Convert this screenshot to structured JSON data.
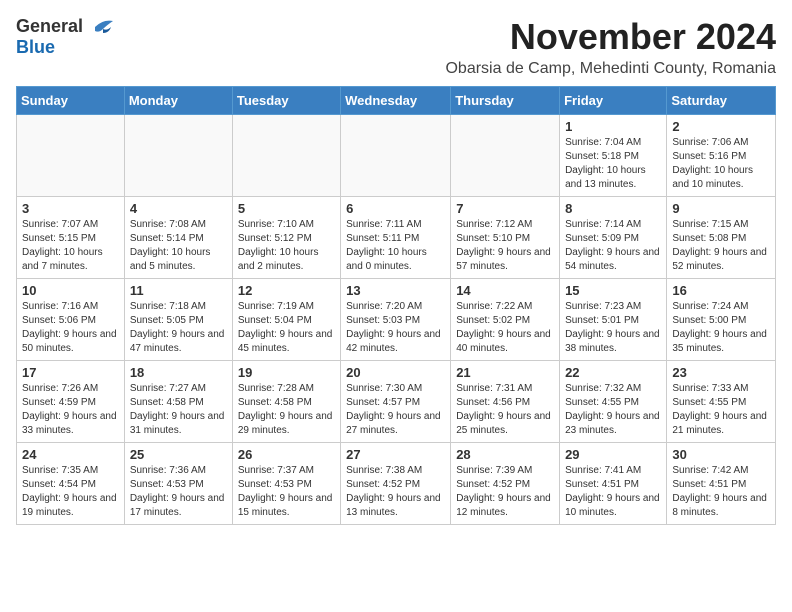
{
  "header": {
    "logo_general": "General",
    "logo_blue": "Blue",
    "month_title": "November 2024",
    "location": "Obarsia de Camp, Mehedinti County, Romania"
  },
  "weekdays": [
    "Sunday",
    "Monday",
    "Tuesday",
    "Wednesday",
    "Thursday",
    "Friday",
    "Saturday"
  ],
  "weeks": [
    [
      {
        "day": "",
        "info": ""
      },
      {
        "day": "",
        "info": ""
      },
      {
        "day": "",
        "info": ""
      },
      {
        "day": "",
        "info": ""
      },
      {
        "day": "",
        "info": ""
      },
      {
        "day": "1",
        "info": "Sunrise: 7:04 AM\nSunset: 5:18 PM\nDaylight: 10 hours and 13 minutes."
      },
      {
        "day": "2",
        "info": "Sunrise: 7:06 AM\nSunset: 5:16 PM\nDaylight: 10 hours and 10 minutes."
      }
    ],
    [
      {
        "day": "3",
        "info": "Sunrise: 7:07 AM\nSunset: 5:15 PM\nDaylight: 10 hours and 7 minutes."
      },
      {
        "day": "4",
        "info": "Sunrise: 7:08 AM\nSunset: 5:14 PM\nDaylight: 10 hours and 5 minutes."
      },
      {
        "day": "5",
        "info": "Sunrise: 7:10 AM\nSunset: 5:12 PM\nDaylight: 10 hours and 2 minutes."
      },
      {
        "day": "6",
        "info": "Sunrise: 7:11 AM\nSunset: 5:11 PM\nDaylight: 10 hours and 0 minutes."
      },
      {
        "day": "7",
        "info": "Sunrise: 7:12 AM\nSunset: 5:10 PM\nDaylight: 9 hours and 57 minutes."
      },
      {
        "day": "8",
        "info": "Sunrise: 7:14 AM\nSunset: 5:09 PM\nDaylight: 9 hours and 54 minutes."
      },
      {
        "day": "9",
        "info": "Sunrise: 7:15 AM\nSunset: 5:08 PM\nDaylight: 9 hours and 52 minutes."
      }
    ],
    [
      {
        "day": "10",
        "info": "Sunrise: 7:16 AM\nSunset: 5:06 PM\nDaylight: 9 hours and 50 minutes."
      },
      {
        "day": "11",
        "info": "Sunrise: 7:18 AM\nSunset: 5:05 PM\nDaylight: 9 hours and 47 minutes."
      },
      {
        "day": "12",
        "info": "Sunrise: 7:19 AM\nSunset: 5:04 PM\nDaylight: 9 hours and 45 minutes."
      },
      {
        "day": "13",
        "info": "Sunrise: 7:20 AM\nSunset: 5:03 PM\nDaylight: 9 hours and 42 minutes."
      },
      {
        "day": "14",
        "info": "Sunrise: 7:22 AM\nSunset: 5:02 PM\nDaylight: 9 hours and 40 minutes."
      },
      {
        "day": "15",
        "info": "Sunrise: 7:23 AM\nSunset: 5:01 PM\nDaylight: 9 hours and 38 minutes."
      },
      {
        "day": "16",
        "info": "Sunrise: 7:24 AM\nSunset: 5:00 PM\nDaylight: 9 hours and 35 minutes."
      }
    ],
    [
      {
        "day": "17",
        "info": "Sunrise: 7:26 AM\nSunset: 4:59 PM\nDaylight: 9 hours and 33 minutes."
      },
      {
        "day": "18",
        "info": "Sunrise: 7:27 AM\nSunset: 4:58 PM\nDaylight: 9 hours and 31 minutes."
      },
      {
        "day": "19",
        "info": "Sunrise: 7:28 AM\nSunset: 4:58 PM\nDaylight: 9 hours and 29 minutes."
      },
      {
        "day": "20",
        "info": "Sunrise: 7:30 AM\nSunset: 4:57 PM\nDaylight: 9 hours and 27 minutes."
      },
      {
        "day": "21",
        "info": "Sunrise: 7:31 AM\nSunset: 4:56 PM\nDaylight: 9 hours and 25 minutes."
      },
      {
        "day": "22",
        "info": "Sunrise: 7:32 AM\nSunset: 4:55 PM\nDaylight: 9 hours and 23 minutes."
      },
      {
        "day": "23",
        "info": "Sunrise: 7:33 AM\nSunset: 4:55 PM\nDaylight: 9 hours and 21 minutes."
      }
    ],
    [
      {
        "day": "24",
        "info": "Sunrise: 7:35 AM\nSunset: 4:54 PM\nDaylight: 9 hours and 19 minutes."
      },
      {
        "day": "25",
        "info": "Sunrise: 7:36 AM\nSunset: 4:53 PM\nDaylight: 9 hours and 17 minutes."
      },
      {
        "day": "26",
        "info": "Sunrise: 7:37 AM\nSunset: 4:53 PM\nDaylight: 9 hours and 15 minutes."
      },
      {
        "day": "27",
        "info": "Sunrise: 7:38 AM\nSunset: 4:52 PM\nDaylight: 9 hours and 13 minutes."
      },
      {
        "day": "28",
        "info": "Sunrise: 7:39 AM\nSunset: 4:52 PM\nDaylight: 9 hours and 12 minutes."
      },
      {
        "day": "29",
        "info": "Sunrise: 7:41 AM\nSunset: 4:51 PM\nDaylight: 9 hours and 10 minutes."
      },
      {
        "day": "30",
        "info": "Sunrise: 7:42 AM\nSunset: 4:51 PM\nDaylight: 9 hours and 8 minutes."
      }
    ]
  ]
}
